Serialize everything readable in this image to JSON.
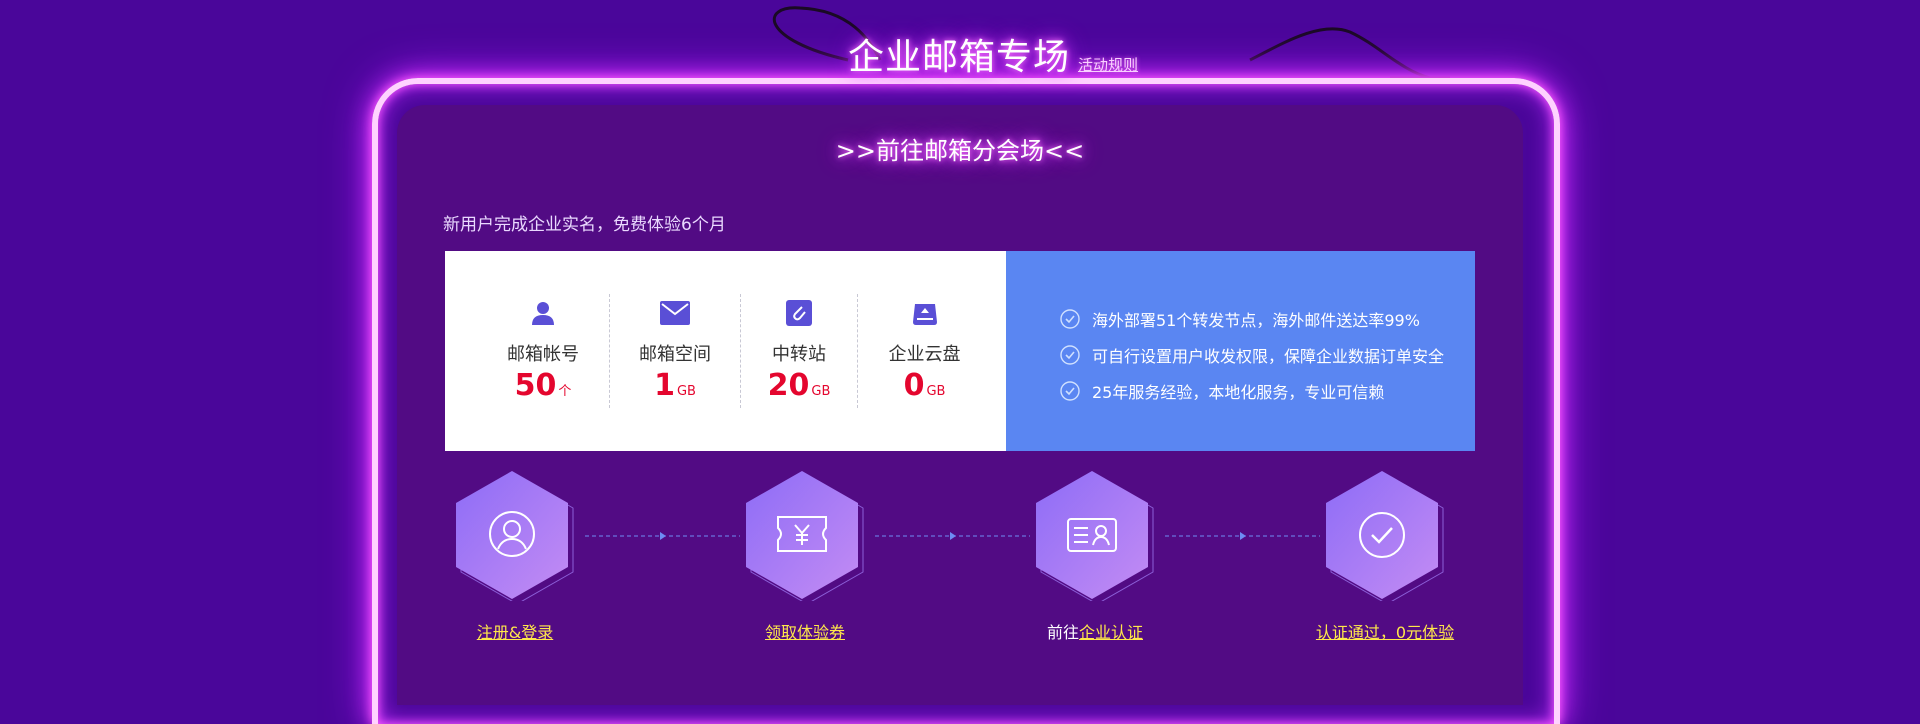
{
  "header": {
    "title": "企业邮箱专场",
    "rules_link": "活动规则"
  },
  "venue_link": ">>前往邮箱分会场<<",
  "promo_text": "新用户完成企业实名，免费体验6个月",
  "features": [
    {
      "icon": "user-icon",
      "label": "邮箱帐号",
      "value": "50",
      "unit": "个"
    },
    {
      "icon": "mail-icon",
      "label": "邮箱空间",
      "value": "1",
      "unit": "GB"
    },
    {
      "icon": "paperclip-icon",
      "label": "中转站",
      "value": "20",
      "unit": "GB"
    },
    {
      "icon": "cloud-drive-icon",
      "label": "企业云盘",
      "value": "0",
      "unit": "GB"
    }
  ],
  "benefits": [
    "海外部署51个转发节点，海外邮件送达率99%",
    "可自行设置用户收发权限，保障企业数据订单安全",
    "25年服务经验，本地化服务，专业可信赖"
  ],
  "steps": [
    {
      "icon": "user-circle-icon",
      "prefix": "",
      "link": "注册&登录"
    },
    {
      "icon": "coupon-icon",
      "prefix": "",
      "link": "领取体验券"
    },
    {
      "icon": "id-card-icon",
      "prefix": "前往",
      "link": "企业认证"
    },
    {
      "icon": "check-circle-icon",
      "prefix": "",
      "link": "认证通过，0元体验"
    }
  ],
  "colors": {
    "background": "#4a069a",
    "panel": "#520b84",
    "neon": "#ff5cff",
    "value_red": "#e4062e",
    "benefit_blue": "#5a86f2",
    "step_link_yellow": "#ffe84a"
  }
}
